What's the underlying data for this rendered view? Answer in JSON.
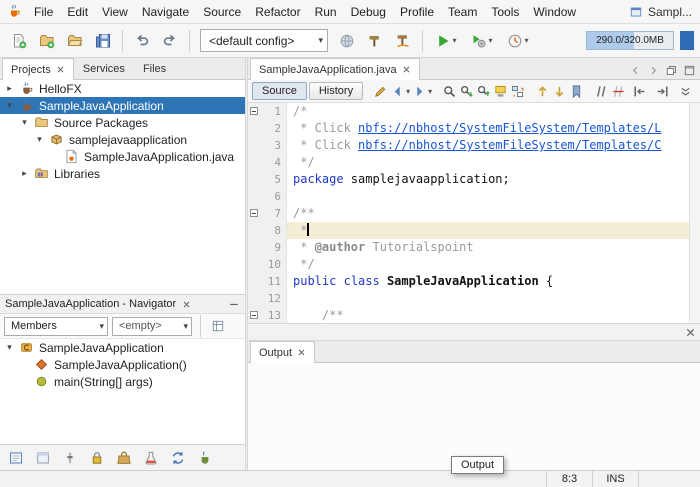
{
  "colors": {
    "selection_bg": "#2e75b6",
    "keyword": "#2038c8",
    "comment": "#9b9b9b",
    "link": "#1a56d6",
    "caret_line_bg": "#f5eed6",
    "memory_fill": "#aecbeb",
    "accent_blue": "#2f6cb5"
  },
  "menubar": {
    "items": [
      "File",
      "Edit",
      "View",
      "Navigate",
      "Source",
      "Refactor",
      "Run",
      "Debug",
      "Profile",
      "Team",
      "Tools",
      "Window"
    ],
    "overflow": "Sampl..."
  },
  "toolbar": {
    "file_group": [
      "new-file-icon",
      "new-project-icon",
      "open-project-icon",
      "save-all-icon"
    ],
    "edit_group": [
      "undo-icon",
      "redo-icon"
    ],
    "config_value": "<default config>",
    "deploy_group": [
      "deploy-icon"
    ],
    "build_group": [
      "build-project-icon",
      "clean-build-icon"
    ],
    "run_group": [
      "run-project-icon",
      "debug-project-icon",
      "profile-project-icon"
    ],
    "memory_text": "290.0/320.0MB",
    "memory_fraction": 0.55
  },
  "explorer": {
    "tabs": [
      {
        "label": "Projects",
        "active": true,
        "closable": true
      },
      {
        "label": "Services",
        "active": false,
        "closable": false
      },
      {
        "label": "Files",
        "active": false,
        "closable": false
      }
    ],
    "tree": [
      {
        "label": "HelloFX",
        "icon": "java-project-icon",
        "level": 0,
        "expander": "collapsed",
        "selected": false
      },
      {
        "label": "SampleJavaApplication",
        "icon": "java-project-icon",
        "level": 0,
        "expander": "expanded",
        "selected": true
      },
      {
        "label": "Source Packages",
        "icon": "source-packages-icon",
        "level": 1,
        "expander": "expanded",
        "selected": false
      },
      {
        "label": "samplejavaapplication",
        "icon": "package-icon",
        "level": 2,
        "expander": "expanded",
        "selected": false
      },
      {
        "label": "SampleJavaApplication.java",
        "icon": "java-file-icon",
        "level": 3,
        "expander": "none",
        "selected": false
      },
      {
        "label": "Libraries",
        "icon": "libraries-icon",
        "level": 1,
        "expander": "collapsed",
        "selected": false
      }
    ]
  },
  "navigator": {
    "title": "SampleJavaApplication - Navigator",
    "filter_value": "Members",
    "secondary_value": "<empty>",
    "tree": [
      {
        "label": "SampleJavaApplication",
        "icon": "class-icon",
        "level": 0,
        "expander": "expanded",
        "selected": false
      },
      {
        "label": "SampleJavaApplication()",
        "icon": "constructor-icon",
        "level": 1,
        "expander": "none",
        "selected": false
      },
      {
        "label": "main(String[] args)",
        "icon": "method-icon",
        "level": 1,
        "expander": "none",
        "selected": false
      }
    ]
  },
  "mini_toolbar": [
    "output-window-icon",
    "form-editor-icon",
    "slider-icon",
    "lock-icon",
    "bag-icon",
    "beaker-icon",
    "sync-icon",
    "java-shortcut-icon"
  ],
  "editor": {
    "tab": {
      "label": "SampleJavaApplication.java"
    },
    "tab_icons": [
      "chevron-left-icon",
      "chevron-right-icon",
      "restore-window-icon",
      "maximize-window-icon"
    ],
    "view_buttons": [
      {
        "label": "Source",
        "active": true
      },
      {
        "label": "History",
        "active": false
      }
    ],
    "toolbar_groups": [
      [
        "last-edited-icon",
        "back-icon",
        "forward-icon"
      ],
      [
        "find-selection-icon",
        "find-next-icon",
        "find-previous-icon",
        "toggle-highlight-icon",
        "replace-icon"
      ],
      [
        "previous-bookmark-icon",
        "next-bookmark-icon",
        "toggle-bookmark-icon"
      ],
      [
        "comment-icon",
        "uncomment-icon"
      ]
    ],
    "toolbar_right": [
      "shift-left-icon",
      "shift-right-icon",
      "collapse-expand-icon",
      "split-editor-icon"
    ],
    "code": {
      "lines": [
        {
          "n": "1",
          "fold": true,
          "segs": [
            {
              "t": "/*",
              "c": "comment"
            }
          ]
        },
        {
          "n": "2",
          "segs": [
            {
              "t": " * Click ",
              "c": "comment"
            },
            {
              "t": "nbfs://nbhost/SystemFileSystem/Templates/L",
              "c": "link"
            }
          ]
        },
        {
          "n": "3",
          "segs": [
            {
              "t": " * Click ",
              "c": "comment"
            },
            {
              "t": "nbfs://nbhost/SystemFileSystem/Templates/C",
              "c": "link"
            }
          ]
        },
        {
          "n": "4",
          "segs": [
            {
              "t": " */",
              "c": "comment"
            }
          ]
        },
        {
          "n": "5",
          "segs": [
            {
              "t": "package",
              "c": "keyword"
            },
            {
              "t": " samplejavaapplication;",
              "c": "plain"
            }
          ]
        },
        {
          "n": "6",
          "segs": []
        },
        {
          "n": "7",
          "fold": true,
          "segs": [
            {
              "t": "/**",
              "c": "comment"
            }
          ]
        },
        {
          "n": "8",
          "current": true,
          "segs": [
            {
              "t": " *",
              "c": "comment"
            }
          ]
        },
        {
          "n": "9",
          "segs": [
            {
              "t": " * ",
              "c": "comment"
            },
            {
              "t": "@author",
              "c": "jdtag"
            },
            {
              "t": " Tutorialspoint",
              "c": "comment"
            }
          ]
        },
        {
          "n": "10",
          "segs": [
            {
              "t": " */",
              "c": "comment"
            }
          ]
        },
        {
          "n": "11",
          "segs": [
            {
              "t": "public",
              "c": "keyword"
            },
            {
              "t": " ",
              "c": "plain"
            },
            {
              "t": "class",
              "c": "keyword"
            },
            {
              "t": " ",
              "c": "plain"
            },
            {
              "t": "SampleJavaApplication",
              "c": "classname"
            },
            {
              "t": " {",
              "c": "plain"
            }
          ]
        },
        {
          "n": "12",
          "segs": []
        },
        {
          "n": "13",
          "fold": true,
          "segs": [
            {
              "t": "    ",
              "c": "plain"
            },
            {
              "t": "/**",
              "c": "comment"
            }
          ]
        }
      ]
    }
  },
  "output": {
    "tab": "Output"
  },
  "statusbar": {
    "tooltip": "Output",
    "caret_position": "8:3",
    "insert_mode": "INS"
  }
}
